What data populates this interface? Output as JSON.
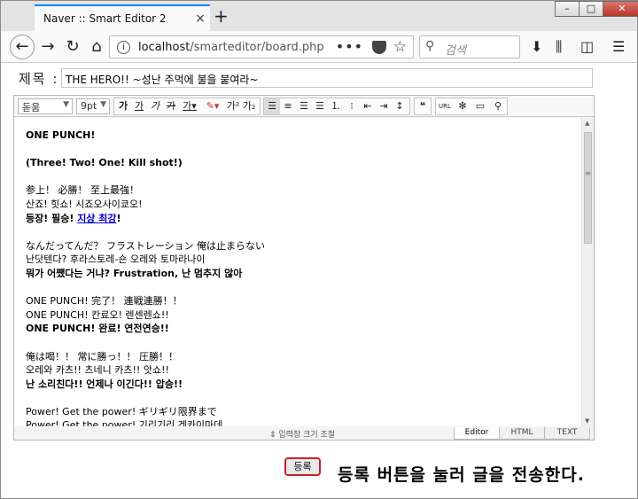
{
  "browser": {
    "tab_title": "Naver :: Smart Editor 2",
    "tab_close": "×",
    "new_tab": "+",
    "url_host": "localhost",
    "url_path": "/smarteditor/board.php",
    "search_placeholder": "검색",
    "window_controls": [
      "–",
      "□",
      "✕"
    ]
  },
  "form": {
    "subject_label": "제목 :",
    "subject_value": "THE HERO!! ~성난 주먹에 불을 붙여라~"
  },
  "toolbar": {
    "font_family": "돋움",
    "font_size": "9pt"
  },
  "content": {
    "lines": [
      {
        "text": "ONE PUNCH!",
        "style": "b"
      },
      {
        "text": "",
        "style": "gap"
      },
      {
        "text": "(Three! Two! One! Kill shot!)",
        "style": "b"
      },
      {
        "text": "",
        "style": "gap"
      },
      {
        "text": "参上！ 必勝！ 至上最強！",
        "style": ""
      },
      {
        "text": "산죠! 힛쇼! 시죠오사이쿄오!",
        "style": ""
      },
      {
        "text": "",
        "style": "gap"
      },
      {
        "text": "なんだってんだ？ フラストレーション 俺は止まらない",
        "style": ""
      },
      {
        "text": "난닷텐다? 후라스토레-숀 오레와 토마라나이",
        "style": ""
      },
      {
        "text": "뭐가 어쨌다는 거냐? Frustration, 난 멈추지 않아",
        "style": "b"
      },
      {
        "text": "",
        "style": "gap"
      },
      {
        "text": "ONE PUNCH! 完了！ 連戦連勝！！",
        "style": ""
      },
      {
        "text": "ONE PUNCH! 칸료오! 렌센렌쇼!!",
        "style": ""
      },
      {
        "text": "ONE PUNCH! 완료! 연전연승!!",
        "style": "b"
      },
      {
        "text": "",
        "style": "gap"
      },
      {
        "text": "俺は喝！！ 常に勝っ！！ 圧勝！！",
        "style": ""
      },
      {
        "text": "오레와 카츠!! 츠네니 카츠!! 앗쇼!!",
        "style": ""
      },
      {
        "text": "난 소리친다!! 언제나 이긴다!! 압승!!",
        "style": "b"
      },
      {
        "text": "",
        "style": "gap"
      },
      {
        "text": "Power! Get the power! ギリギリ限界まで",
        "style": ""
      },
      {
        "text": "Power! Get the power! 기리기리 겐카이마데",
        "style": ""
      }
    ],
    "line_7": {
      "prefix": "등장! 필승! ",
      "link": "지상 최강",
      "suffix": "!"
    }
  },
  "editor_footer": {
    "resize_label": "⇕ 입력창 크기 조절",
    "modes": [
      "Editor",
      "HTML",
      "TEXT"
    ]
  },
  "submit_label": "등록",
  "caption": "등록 버튼을 눌러 글을 전송한다."
}
